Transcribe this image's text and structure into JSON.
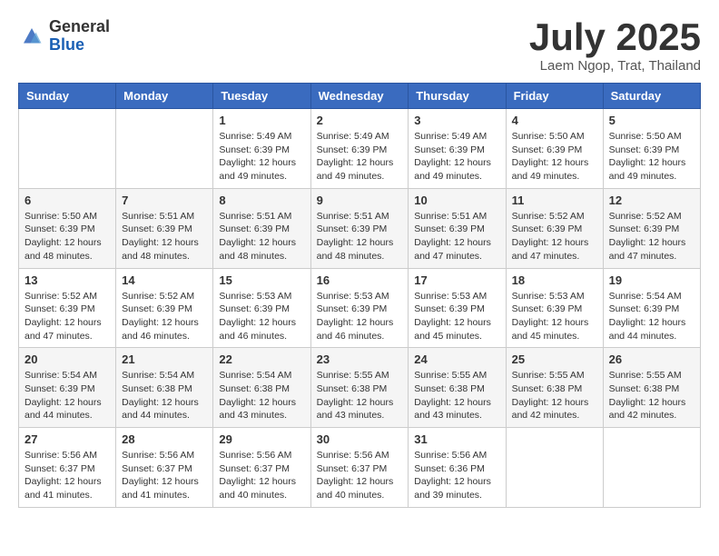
{
  "header": {
    "logo_general": "General",
    "logo_blue": "Blue",
    "month_title": "July 2025",
    "subtitle": "Laem Ngop, Trat, Thailand"
  },
  "calendar": {
    "days_of_week": [
      "Sunday",
      "Monday",
      "Tuesday",
      "Wednesday",
      "Thursday",
      "Friday",
      "Saturday"
    ],
    "weeks": [
      [
        {
          "day": "",
          "sunrise": "",
          "sunset": "",
          "daylight": ""
        },
        {
          "day": "",
          "sunrise": "",
          "sunset": "",
          "daylight": ""
        },
        {
          "day": "1",
          "sunrise": "Sunrise: 5:49 AM",
          "sunset": "Sunset: 6:39 PM",
          "daylight": "Daylight: 12 hours and 49 minutes."
        },
        {
          "day": "2",
          "sunrise": "Sunrise: 5:49 AM",
          "sunset": "Sunset: 6:39 PM",
          "daylight": "Daylight: 12 hours and 49 minutes."
        },
        {
          "day": "3",
          "sunrise": "Sunrise: 5:49 AM",
          "sunset": "Sunset: 6:39 PM",
          "daylight": "Daylight: 12 hours and 49 minutes."
        },
        {
          "day": "4",
          "sunrise": "Sunrise: 5:50 AM",
          "sunset": "Sunset: 6:39 PM",
          "daylight": "Daylight: 12 hours and 49 minutes."
        },
        {
          "day": "5",
          "sunrise": "Sunrise: 5:50 AM",
          "sunset": "Sunset: 6:39 PM",
          "daylight": "Daylight: 12 hours and 49 minutes."
        }
      ],
      [
        {
          "day": "6",
          "sunrise": "Sunrise: 5:50 AM",
          "sunset": "Sunset: 6:39 PM",
          "daylight": "Daylight: 12 hours and 48 minutes."
        },
        {
          "day": "7",
          "sunrise": "Sunrise: 5:51 AM",
          "sunset": "Sunset: 6:39 PM",
          "daylight": "Daylight: 12 hours and 48 minutes."
        },
        {
          "day": "8",
          "sunrise": "Sunrise: 5:51 AM",
          "sunset": "Sunset: 6:39 PM",
          "daylight": "Daylight: 12 hours and 48 minutes."
        },
        {
          "day": "9",
          "sunrise": "Sunrise: 5:51 AM",
          "sunset": "Sunset: 6:39 PM",
          "daylight": "Daylight: 12 hours and 48 minutes."
        },
        {
          "day": "10",
          "sunrise": "Sunrise: 5:51 AM",
          "sunset": "Sunset: 6:39 PM",
          "daylight": "Daylight: 12 hours and 47 minutes."
        },
        {
          "day": "11",
          "sunrise": "Sunrise: 5:52 AM",
          "sunset": "Sunset: 6:39 PM",
          "daylight": "Daylight: 12 hours and 47 minutes."
        },
        {
          "day": "12",
          "sunrise": "Sunrise: 5:52 AM",
          "sunset": "Sunset: 6:39 PM",
          "daylight": "Daylight: 12 hours and 47 minutes."
        }
      ],
      [
        {
          "day": "13",
          "sunrise": "Sunrise: 5:52 AM",
          "sunset": "Sunset: 6:39 PM",
          "daylight": "Daylight: 12 hours and 47 minutes."
        },
        {
          "day": "14",
          "sunrise": "Sunrise: 5:52 AM",
          "sunset": "Sunset: 6:39 PM",
          "daylight": "Daylight: 12 hours and 46 minutes."
        },
        {
          "day": "15",
          "sunrise": "Sunrise: 5:53 AM",
          "sunset": "Sunset: 6:39 PM",
          "daylight": "Daylight: 12 hours and 46 minutes."
        },
        {
          "day": "16",
          "sunrise": "Sunrise: 5:53 AM",
          "sunset": "Sunset: 6:39 PM",
          "daylight": "Daylight: 12 hours and 46 minutes."
        },
        {
          "day": "17",
          "sunrise": "Sunrise: 5:53 AM",
          "sunset": "Sunset: 6:39 PM",
          "daylight": "Daylight: 12 hours and 45 minutes."
        },
        {
          "day": "18",
          "sunrise": "Sunrise: 5:53 AM",
          "sunset": "Sunset: 6:39 PM",
          "daylight": "Daylight: 12 hours and 45 minutes."
        },
        {
          "day": "19",
          "sunrise": "Sunrise: 5:54 AM",
          "sunset": "Sunset: 6:39 PM",
          "daylight": "Daylight: 12 hours and 44 minutes."
        }
      ],
      [
        {
          "day": "20",
          "sunrise": "Sunrise: 5:54 AM",
          "sunset": "Sunset: 6:39 PM",
          "daylight": "Daylight: 12 hours and 44 minutes."
        },
        {
          "day": "21",
          "sunrise": "Sunrise: 5:54 AM",
          "sunset": "Sunset: 6:38 PM",
          "daylight": "Daylight: 12 hours and 44 minutes."
        },
        {
          "day": "22",
          "sunrise": "Sunrise: 5:54 AM",
          "sunset": "Sunset: 6:38 PM",
          "daylight": "Daylight: 12 hours and 43 minutes."
        },
        {
          "day": "23",
          "sunrise": "Sunrise: 5:55 AM",
          "sunset": "Sunset: 6:38 PM",
          "daylight": "Daylight: 12 hours and 43 minutes."
        },
        {
          "day": "24",
          "sunrise": "Sunrise: 5:55 AM",
          "sunset": "Sunset: 6:38 PM",
          "daylight": "Daylight: 12 hours and 43 minutes."
        },
        {
          "day": "25",
          "sunrise": "Sunrise: 5:55 AM",
          "sunset": "Sunset: 6:38 PM",
          "daylight": "Daylight: 12 hours and 42 minutes."
        },
        {
          "day": "26",
          "sunrise": "Sunrise: 5:55 AM",
          "sunset": "Sunset: 6:38 PM",
          "daylight": "Daylight: 12 hours and 42 minutes."
        }
      ],
      [
        {
          "day": "27",
          "sunrise": "Sunrise: 5:56 AM",
          "sunset": "Sunset: 6:37 PM",
          "daylight": "Daylight: 12 hours and 41 minutes."
        },
        {
          "day": "28",
          "sunrise": "Sunrise: 5:56 AM",
          "sunset": "Sunset: 6:37 PM",
          "daylight": "Daylight: 12 hours and 41 minutes."
        },
        {
          "day": "29",
          "sunrise": "Sunrise: 5:56 AM",
          "sunset": "Sunset: 6:37 PM",
          "daylight": "Daylight: 12 hours and 40 minutes."
        },
        {
          "day": "30",
          "sunrise": "Sunrise: 5:56 AM",
          "sunset": "Sunset: 6:37 PM",
          "daylight": "Daylight: 12 hours and 40 minutes."
        },
        {
          "day": "31",
          "sunrise": "Sunrise: 5:56 AM",
          "sunset": "Sunset: 6:36 PM",
          "daylight": "Daylight: 12 hours and 39 minutes."
        },
        {
          "day": "",
          "sunrise": "",
          "sunset": "",
          "daylight": ""
        },
        {
          "day": "",
          "sunrise": "",
          "sunset": "",
          "daylight": ""
        }
      ]
    ]
  }
}
